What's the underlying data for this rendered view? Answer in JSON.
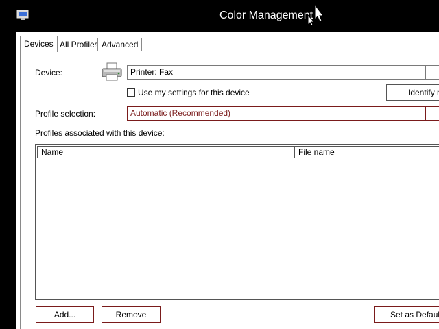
{
  "window": {
    "title": "Color Management"
  },
  "tabs": [
    {
      "label": "Devices",
      "active": true
    },
    {
      "label": "All Profiles",
      "active": false
    },
    {
      "label": "Advanced",
      "active": false
    }
  ],
  "device": {
    "label": "Device:",
    "value": "Printer: Fax",
    "icon": "printer-icon"
  },
  "use_settings": {
    "label": "Use my settings for this device",
    "checked": false
  },
  "identify_button": {
    "label": "Identify m"
  },
  "profile_selection": {
    "label": "Profile selection:",
    "value": "Automatic (Recommended)"
  },
  "profiles": {
    "label": "Profiles associated with this device:",
    "columns": [
      "Name",
      "File name"
    ],
    "rows": []
  },
  "buttons": {
    "add": "Add...",
    "remove": "Remove",
    "set_default": "Set as Default"
  },
  "colors": {
    "accent_border": "#7a1b1b",
    "titlebar": "#000000"
  }
}
